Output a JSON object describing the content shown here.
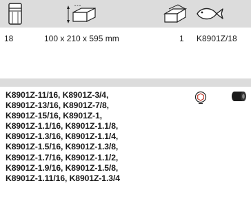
{
  "header": {
    "icons": [
      "socket-icon",
      "box-dimensions-icon",
      "package-icon",
      "fish-icon"
    ]
  },
  "info": {
    "quantity": "18",
    "dimensions": "100 x 210 x 595 mm",
    "pack_count": "1",
    "reference": "K8901Z/18"
  },
  "contents": {
    "lines": [
      "K8901Z-11/16, K8901Z-3/4,",
      "K8901Z-13/16, K8901Z-7/8,",
      "K8901Z-15/16, K8901Z-1,",
      "K8901Z-1.1/16, K8901Z-1.1/8,",
      "K8901Z-1.3/16, K8901Z-1.1/4,",
      "K8901Z-1.5/16, K8901Z-1.3/8,",
      "K8901Z-1.7/16, K8901Z-1.1/2,",
      "K8901Z-1.9/16, K8901Z-1.5/8,",
      "K8901Z-1.11/16, K8901Z-1.3/4"
    ],
    "icons": [
      "hex-profile-icon",
      "impact-socket-icon"
    ]
  }
}
